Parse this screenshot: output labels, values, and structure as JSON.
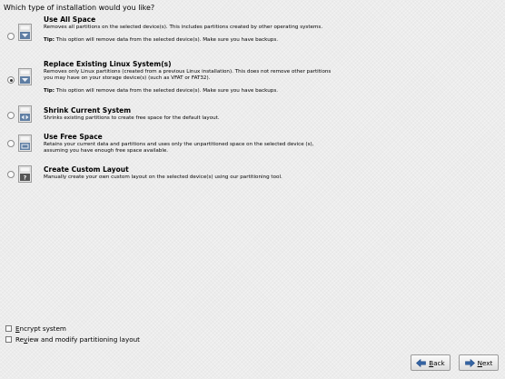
{
  "question": "Which type of installation would you like?",
  "options": [
    {
      "title": "Use All Space",
      "desc": "Removes all partitions on the selected device(s).  This includes partitions created by other operating systems.",
      "tip_label": "Tip:",
      "tip_text": " This option will remove data from the selected device(s).  Make sure you have backups.",
      "selected": false,
      "icon": "disk-all-space-icon"
    },
    {
      "title": "Replace Existing Linux System(s)",
      "desc": "Removes only Linux partitions (created from a previous Linux installation).  This does not remove other partitions you may have on your storage device(s) (such as VFAT or FAT32).",
      "tip_label": "Tip:",
      "tip_text": " This option will remove data from the selected device(s).  Make sure you have backups.",
      "selected": true,
      "icon": "disk-replace-linux-icon"
    },
    {
      "title": "Shrink Current System",
      "desc": "Shrinks existing partitions to create free space for the default layout.",
      "selected": false,
      "icon": "disk-shrink-icon"
    },
    {
      "title": "Use Free Space",
      "desc": "Retains your current data and partitions and uses only the unpartitioned space on the selected device (s), assuming you have enough free space available.",
      "selected": false,
      "icon": "disk-free-space-icon"
    },
    {
      "title": "Create Custom Layout",
      "desc": "Manually create your own custom layout on the selected device(s) using our partitioning tool.",
      "selected": false,
      "icon": "disk-custom-layout-icon"
    }
  ],
  "checkboxes": {
    "encrypt": {
      "mnemonic": "E",
      "rest": "ncrypt system",
      "checked": false
    },
    "review": {
      "before": "Re",
      "mnemonic": "v",
      "rest": "iew and modify partitioning layout",
      "checked": false
    }
  },
  "buttons": {
    "back": {
      "mnemonic": "B",
      "rest": "ack"
    },
    "next": {
      "mnemonic": "N",
      "rest": "ext"
    }
  },
  "colors": {
    "arrow_blue": "#3465a4",
    "disk_bg": "#5f7ea3"
  }
}
